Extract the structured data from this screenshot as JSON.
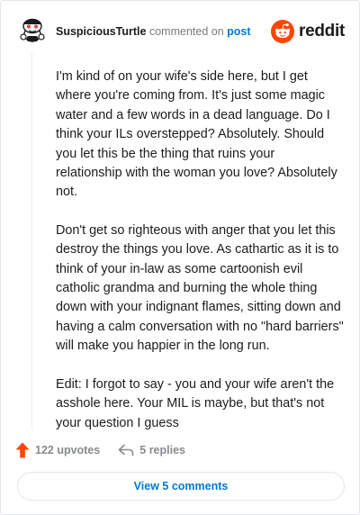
{
  "comment": {
    "username": "SuspiciousTurtle",
    "action_text": "commented on",
    "target_text": "post",
    "paragraphs": [
      "I'm kind of on your wife's side here, but I get where you're coming from. It's just some magic water and a few words in a dead language. Do I think your ILs overstepped? Absolutely. Should you let this be the thing that ruins your relationship with the woman you love? Absolutely not.",
      "Don't get so righteous with anger that you let this destroy the things you love. As cathartic as it is to think of your in-law as some cartoonish evil catholic grandma and burning the whole thing down with your indignant flames, sitting down and having a calm conversation with no \"hard barriers\" will make you happier in the long run.",
      "Edit: I forgot to say - you and your wife aren't the asshole here. Your MIL is maybe, but that's not your question I guess"
    ]
  },
  "brand": {
    "name": "reddit",
    "icon": "reddit-logo-icon",
    "color": "#ff4500"
  },
  "footer": {
    "upvotes_label": "122 upvotes",
    "replies_label": "5 replies",
    "view_comments_label": "View 5 comments",
    "upvote_icon": "upvote-arrow-icon",
    "reply_icon": "reply-arrow-icon"
  },
  "colors": {
    "link_blue": "#0079d3",
    "muted_gray": "#878a8c",
    "upvote_orange": "#ff4500"
  }
}
